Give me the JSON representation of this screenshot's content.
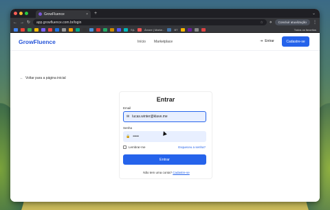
{
  "browser": {
    "tab_title": "GrowFluence",
    "tab_close": "×",
    "new_tab": "+",
    "url": "app.growfluence.com.br/login",
    "update_label": "Concluir atualização",
    "bookmarks_more": "Todos os favoritos",
    "bookmark_text_1": "Árvore | Marke...",
    "bookmark_text_2": "BT",
    "bookmark_text_3": "S|L"
  },
  "nav": {
    "brand": "GrowFluence",
    "links": [
      "Início",
      "Marketplace"
    ],
    "login_label": "Entrar",
    "signup_label": "Cadastre-se"
  },
  "back_link": "Voltar para a página inicial",
  "login": {
    "title": "Entrar",
    "email_label": "Email",
    "email_value": "lucas.winter@klave.me",
    "password_label": "Senha",
    "password_value": "•••••",
    "remember_label": "Lembrar-me",
    "forgot_label": "Esqueceu a senha?",
    "submit_label": "Entrar",
    "no_account_text": "Não tem uma conta?",
    "signup_link": "Cadastre-se"
  },
  "colors": {
    "brand": "#2563eb"
  }
}
